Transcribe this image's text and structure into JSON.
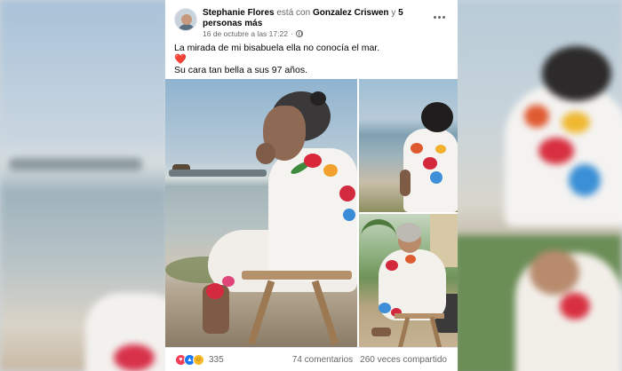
{
  "post": {
    "author": "Stephanie Flores",
    "with_text": "está con",
    "tagged": "Gonzalez Criswen",
    "and_text": "y",
    "others": "5 personas más",
    "timestamp": "16 de octubre a las 17:22",
    "separator": "·",
    "privacy_icon": "globe-icon",
    "line1": "La mirada de mi bisabuela ella no conocía el mar.",
    "heart": "❤️",
    "line3": "Su cara tan bella a sus 97 años."
  },
  "reactions": {
    "icons": [
      "love-icon",
      "like-icon",
      "care-icon"
    ],
    "count": "335"
  },
  "stats": {
    "comments": "74 comentarios",
    "shares": "260 veces compartido"
  },
  "colors": {
    "like": "#1877f2",
    "love": "#f33e58",
    "care": "#f7b928",
    "muted_text": "#65676b"
  }
}
